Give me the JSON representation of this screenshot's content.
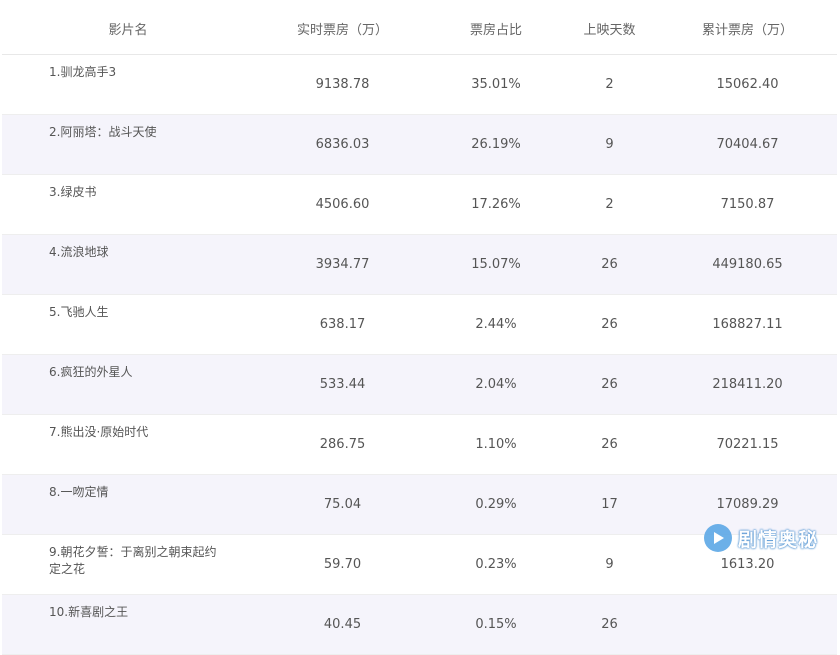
{
  "table": {
    "headers": [
      "影片名",
      "实时票房（万）",
      "票房占比",
      "上映天数",
      "累计票房（万）"
    ],
    "rows": [
      {
        "name": "1.驯龙高手3",
        "realtime": "9138.78",
        "share": "35.01%",
        "days": "2",
        "total": "15062.40"
      },
      {
        "name": "2.阿丽塔：战斗天使",
        "realtime": "6836.03",
        "share": "26.19%",
        "days": "9",
        "total": "70404.67"
      },
      {
        "name": "3.绿皮书",
        "realtime": "4506.60",
        "share": "17.26%",
        "days": "2",
        "total": "7150.87"
      },
      {
        "name": "4.流浪地球",
        "realtime": "3934.77",
        "share": "15.07%",
        "days": "26",
        "total": "449180.65"
      },
      {
        "name": "5.飞驰人生",
        "realtime": "638.17",
        "share": "2.44%",
        "days": "26",
        "total": "168827.11"
      },
      {
        "name": "6.疯狂的外星人",
        "realtime": "533.44",
        "share": "2.04%",
        "days": "26",
        "total": "218411.20"
      },
      {
        "name": "7.熊出没·原始时代",
        "realtime": "286.75",
        "share": "1.10%",
        "days": "26",
        "total": "70221.15"
      },
      {
        "name": "8.一吻定情",
        "realtime": "75.04",
        "share": "0.29%",
        "days": "17",
        "total": "17089.29"
      },
      {
        "name": "9.朝花夕誓：于离别之朝束起约定之花",
        "realtime": "59.70",
        "share": "0.23%",
        "days": "9",
        "total": "1613.20"
      },
      {
        "name": "10.新喜剧之王",
        "realtime": "40.45",
        "share": "0.15%",
        "days": "26",
        "total": ""
      }
    ]
  },
  "watermark": {
    "text": "剧情奥秘",
    "icon": "play-circle-icon"
  },
  "colors": {
    "even_row_bg": "#f5f4fb",
    "text": "#555555",
    "watermark_blue": "#5da8e6"
  }
}
